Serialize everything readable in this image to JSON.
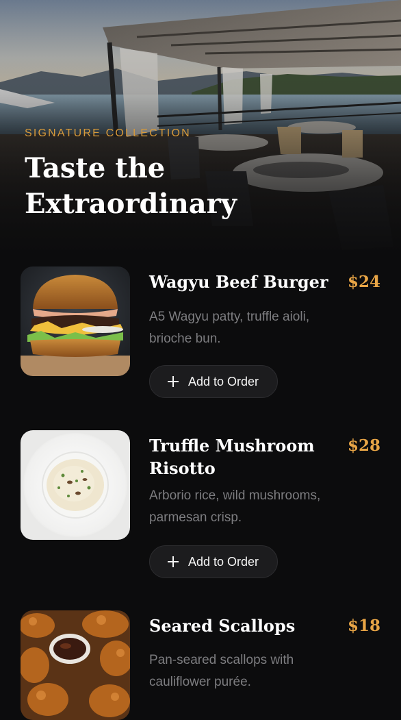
{
  "hero": {
    "eyebrow": "SIGNATURE COLLECTION",
    "title": "Taste the Extraordinary",
    "image_icon": "restaurant-terrace-photo"
  },
  "menu": {
    "add_label": "Add to Order",
    "items": [
      {
        "name": "Wagyu Beef Burger",
        "price": "$24",
        "description": "A5 Wagyu patty, truffle aioli, brioche bun.",
        "image_icon": "burger-photo"
      },
      {
        "name": "Truffle Mushroom Risotto",
        "price": "$28",
        "description": "Arborio rice, wild mushrooms, parmesan crisp.",
        "image_icon": "risotto-photo"
      },
      {
        "name": "Seared Scallops",
        "price": "$18",
        "description": "Pan-seared scallops with cauliflower purée.",
        "image_icon": "fried-dish-photo"
      }
    ]
  },
  "colors": {
    "background": "#0c0c0d",
    "accent": "#e8a546",
    "eyebrow": "#d89a3a",
    "button_bg": "#1c1c1e",
    "muted_text": "#7d7d80"
  }
}
